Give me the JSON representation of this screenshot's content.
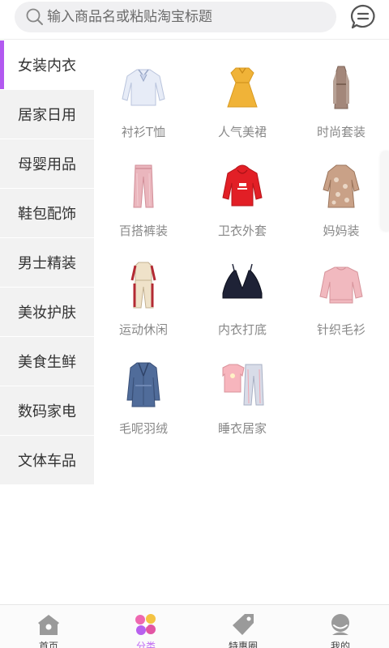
{
  "search": {
    "placeholder": "输入商品名或粘贴淘宝标题"
  },
  "header": {
    "message_icon": "message-icon"
  },
  "sidebar": {
    "active_color": "#b259f0",
    "items": [
      {
        "label": "女装内衣",
        "active": true
      },
      {
        "label": "居家日用"
      },
      {
        "label": "母婴用品"
      },
      {
        "label": "鞋包配饰"
      },
      {
        "label": "男士精装"
      },
      {
        "label": "美妆护肤"
      },
      {
        "label": "美食生鲜"
      },
      {
        "label": "数码家电"
      },
      {
        "label": "文体车品"
      }
    ]
  },
  "categories": [
    {
      "label": "衬衫T恤",
      "icon": "blouse-icon"
    },
    {
      "label": "人气美裙",
      "icon": "yellow-dress-icon"
    },
    {
      "label": "时尚套装",
      "icon": "suit-dress-icon"
    },
    {
      "label": "百搭裤装",
      "icon": "pants-icon"
    },
    {
      "label": "卫衣外套",
      "icon": "red-hoodie-icon"
    },
    {
      "label": "妈妈装",
      "icon": "floral-dress-icon"
    },
    {
      "label": "运动休闲",
      "icon": "sportswear-icon"
    },
    {
      "label": "内衣打底",
      "icon": "bra-icon"
    },
    {
      "label": "针织毛衫",
      "icon": "pink-sweater-icon"
    },
    {
      "label": "毛呢羽绒",
      "icon": "wool-coat-icon"
    },
    {
      "label": "睡衣居家",
      "icon": "pajamas-icon"
    }
  ],
  "tabbar": {
    "accent": "#c16cf2",
    "items": [
      {
        "label": "首页",
        "icon": "home-icon"
      },
      {
        "label": "分类",
        "icon": "category-icon",
        "active": true
      },
      {
        "label": "特惠圈",
        "icon": "tag-icon"
      },
      {
        "label": "我的",
        "icon": "profile-icon"
      }
    ]
  }
}
